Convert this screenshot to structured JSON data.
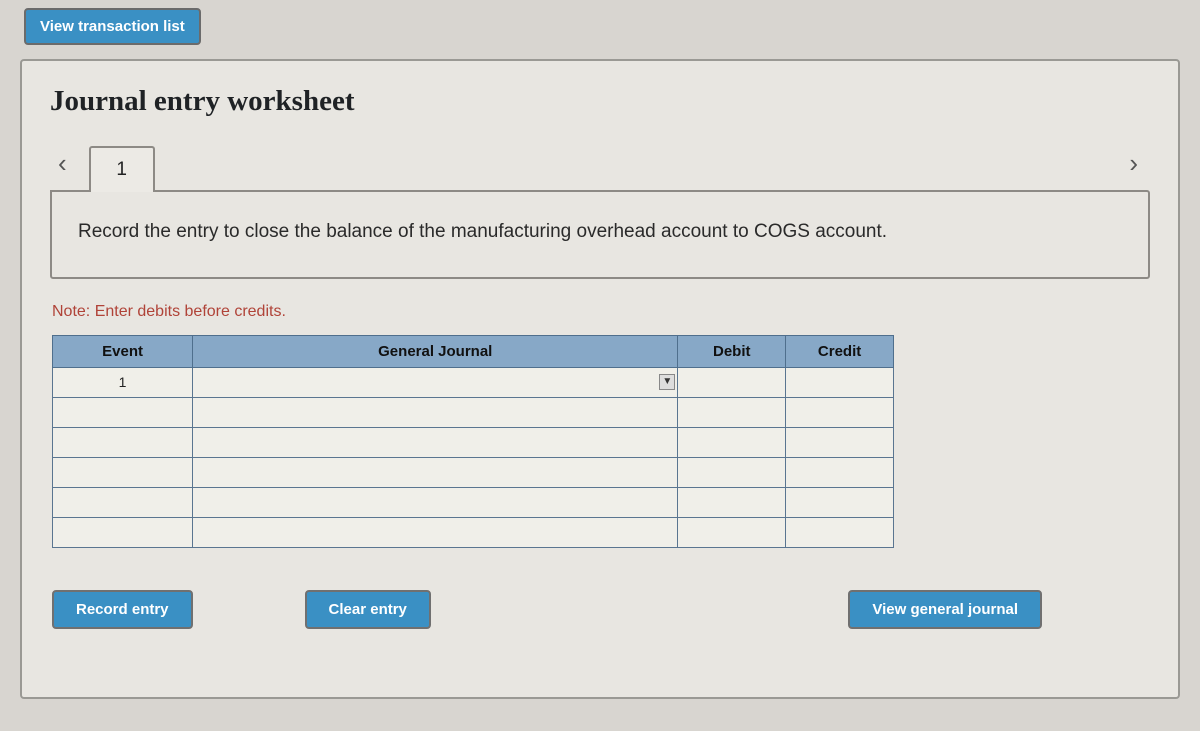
{
  "top_button": "View transaction list",
  "title": "Journal entry worksheet",
  "nav": {
    "prev": "‹",
    "next": "›"
  },
  "tabs": [
    {
      "label": "1"
    }
  ],
  "instruction": "Record the entry to close the balance of the manufacturing overhead account to COGS account.",
  "note": "Note: Enter debits before credits.",
  "table": {
    "headers": {
      "event": "Event",
      "journal": "General Journal",
      "debit": "Debit",
      "credit": "Credit"
    },
    "rows": [
      {
        "event": "1",
        "journal": "",
        "debit": "",
        "credit": ""
      },
      {
        "event": "",
        "journal": "",
        "debit": "",
        "credit": ""
      },
      {
        "event": "",
        "journal": "",
        "debit": "",
        "credit": ""
      },
      {
        "event": "",
        "journal": "",
        "debit": "",
        "credit": ""
      },
      {
        "event": "",
        "journal": "",
        "debit": "",
        "credit": ""
      },
      {
        "event": "",
        "journal": "",
        "debit": "",
        "credit": ""
      }
    ]
  },
  "buttons": {
    "record": "Record entry",
    "clear": "Clear entry",
    "view": "View general journal"
  }
}
